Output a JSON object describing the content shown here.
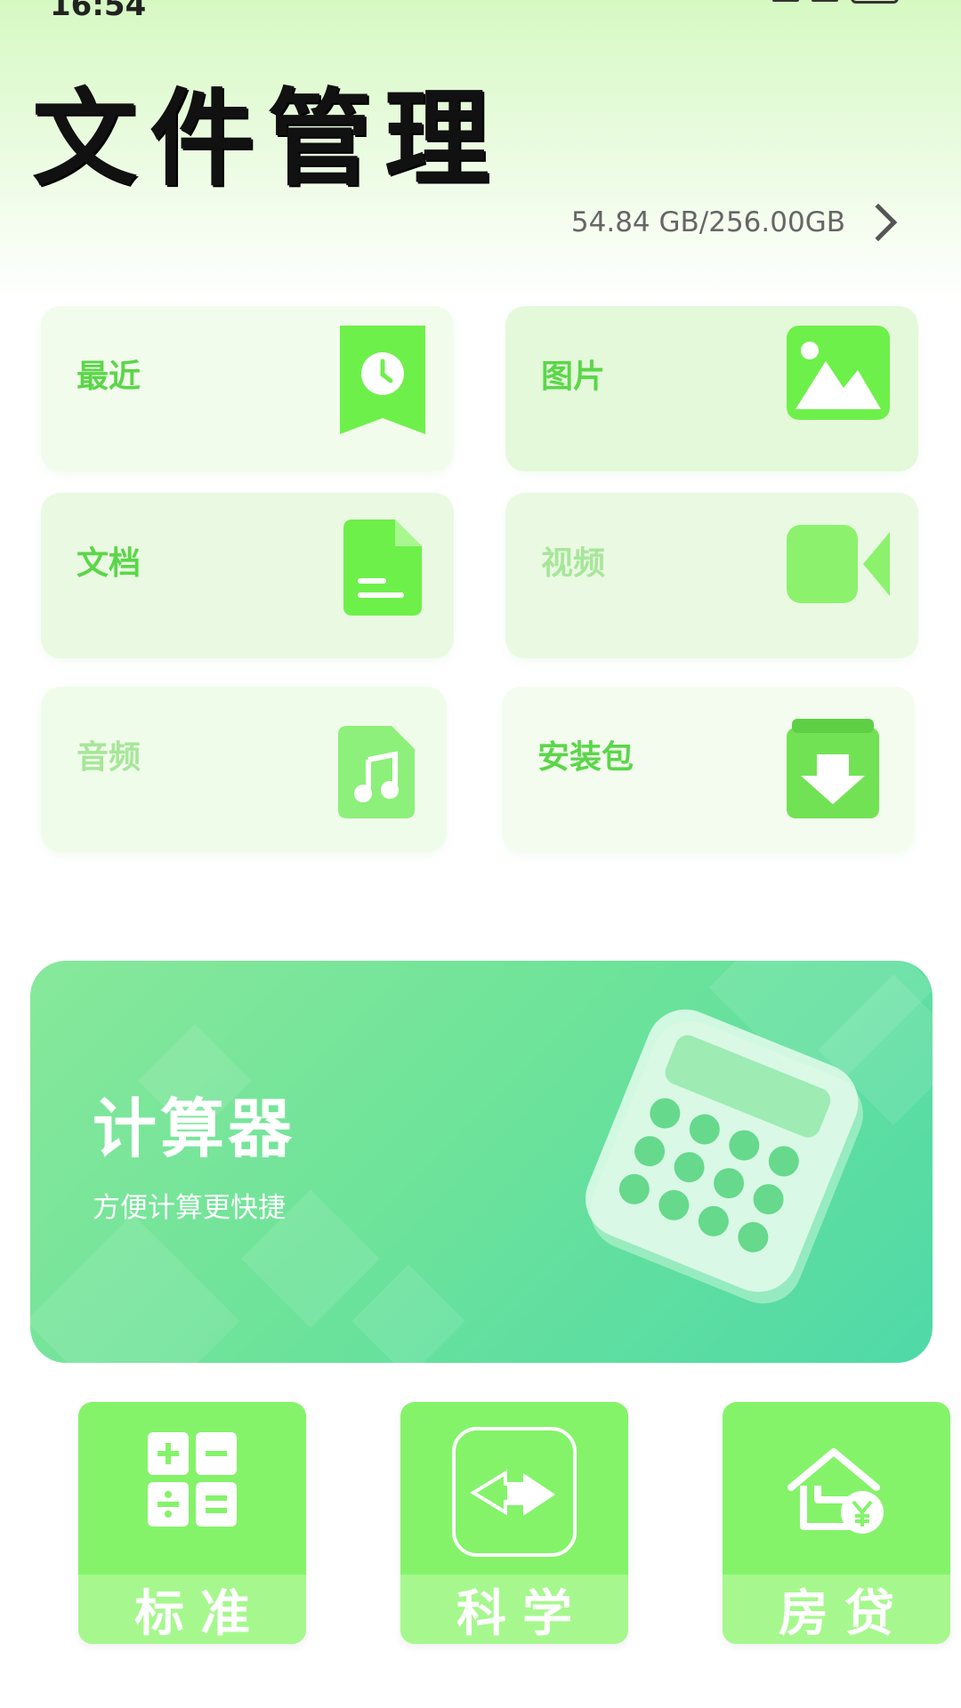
{
  "status_bar": {
    "time": "16:54"
  },
  "header": {
    "title": "文件管理"
  },
  "storage": {
    "text": "54.84 GB/256.00GB"
  },
  "categories": [
    {
      "label": "最近",
      "icon": "clock-bookmark-icon"
    },
    {
      "label": "图片",
      "icon": "image-icon"
    },
    {
      "label": "文档",
      "icon": "document-icon"
    },
    {
      "label": "视频",
      "icon": "video-camera-icon"
    },
    {
      "label": "音频",
      "icon": "music-note-icon"
    },
    {
      "label": "安装包",
      "icon": "package-download-icon"
    }
  ],
  "banner": {
    "title": "计算器",
    "subtitle": "方便计算更快捷",
    "icon": "calculator-illustration"
  },
  "tools": [
    {
      "label": "标准",
      "icon": "standard-calculator-icon"
    },
    {
      "label": "科学",
      "icon": "unit-convert-icon"
    },
    {
      "label": "房贷",
      "icon": "house-loan-icon"
    }
  ],
  "colors": {
    "accent": "#5bd64a",
    "icon_green": "#6ef04a",
    "banner_start": "#87e89a",
    "banner_end": "#4fd9a8",
    "tool_green": "#84f36a"
  }
}
